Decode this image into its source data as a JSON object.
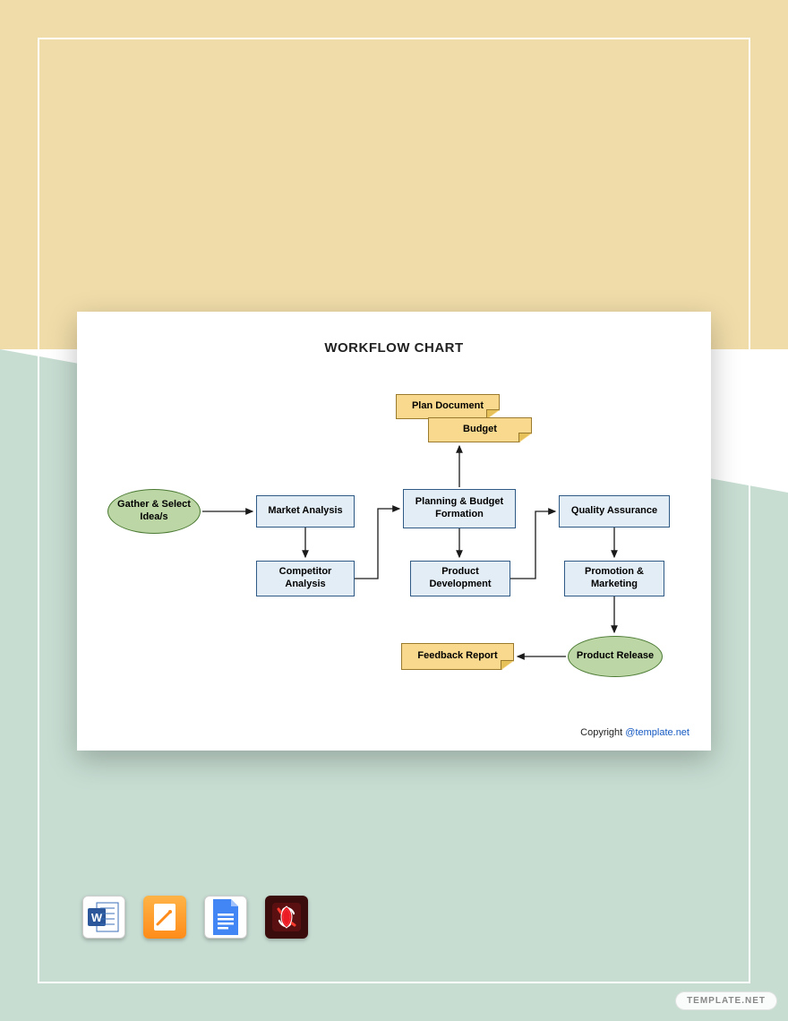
{
  "card": {
    "title": "WORKFLOW CHART",
    "copyright_prefix": "Copyright ",
    "copyright_link": "@template.net"
  },
  "nodes": {
    "gather": "Gather & Select Idea/s",
    "market": "Market Analysis",
    "competitor": "Competitor Analysis",
    "planning": "Planning & Budget Formation",
    "plan_doc": "Plan Document",
    "budget": "Budget",
    "product_dev": "Product Development",
    "qa": "Quality Assurance",
    "promo": "Promotion & Marketing",
    "release": "Product Release",
    "feedback": "Feedback Report"
  },
  "icons": {
    "word": "word-icon",
    "pages": "pages-icon",
    "gdoc": "google-docs-icon",
    "pdf": "pdf-icon"
  },
  "watermark": "TEMPLATE.NET",
  "chart_data": {
    "type": "flowchart",
    "title": "WORKFLOW CHART",
    "nodes": [
      {
        "id": "gather",
        "label": "Gather & Select Idea/s",
        "shape": "ellipse",
        "class": "start"
      },
      {
        "id": "market",
        "label": "Market Analysis",
        "shape": "rect",
        "class": "process"
      },
      {
        "id": "competitor",
        "label": "Competitor Analysis",
        "shape": "rect",
        "class": "process"
      },
      {
        "id": "planning",
        "label": "Planning & Budget Formation",
        "shape": "rect",
        "class": "process"
      },
      {
        "id": "plan_doc",
        "label": "Plan Document",
        "shape": "document",
        "class": "document"
      },
      {
        "id": "budget",
        "label": "Budget",
        "shape": "document",
        "class": "document"
      },
      {
        "id": "product_dev",
        "label": "Product Development",
        "shape": "rect",
        "class": "process"
      },
      {
        "id": "qa",
        "label": "Quality Assurance",
        "shape": "rect",
        "class": "process"
      },
      {
        "id": "promo",
        "label": "Promotion & Marketing",
        "shape": "rect",
        "class": "process"
      },
      {
        "id": "release",
        "label": "Product Release",
        "shape": "ellipse",
        "class": "end"
      },
      {
        "id": "feedback",
        "label": "Feedback Report",
        "shape": "document",
        "class": "document"
      }
    ],
    "edges": [
      {
        "from": "gather",
        "to": "market"
      },
      {
        "from": "market",
        "to": "competitor"
      },
      {
        "from": "competitor",
        "to": "planning"
      },
      {
        "from": "planning",
        "to": "plan_doc"
      },
      {
        "from": "planning",
        "to": "budget"
      },
      {
        "from": "planning",
        "to": "product_dev"
      },
      {
        "from": "product_dev",
        "to": "qa"
      },
      {
        "from": "qa",
        "to": "promo"
      },
      {
        "from": "promo",
        "to": "release"
      },
      {
        "from": "release",
        "to": "feedback"
      }
    ]
  }
}
